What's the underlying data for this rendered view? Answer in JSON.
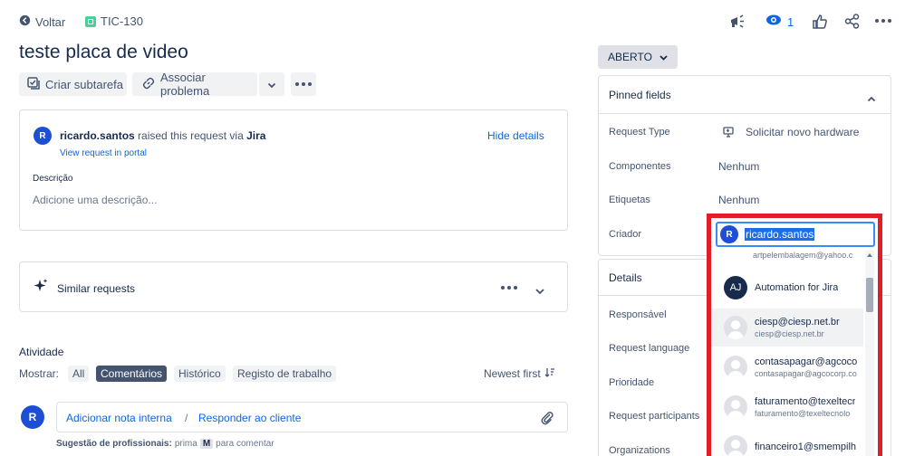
{
  "topbar": {
    "back_label": "Voltar",
    "issue_key": "TIC-130",
    "watch_count": "1"
  },
  "issue": {
    "title": "teste placa de video",
    "buttons": {
      "create_subtask": "Criar subtarefa",
      "link_issue": "Associar problema"
    }
  },
  "request_card": {
    "avatar_letter": "R",
    "user": "ricardo.santos",
    "raised_text": "raised this request via",
    "channel": "Jira",
    "view_portal": "View request in portal",
    "hide_details": "Hide details",
    "description_label": "Descrição",
    "description_placeholder": "Adicione uma descrição..."
  },
  "similar": {
    "label": "Similar requests"
  },
  "activity": {
    "heading": "Atividade",
    "show_label": "Mostrar:",
    "tabs": [
      "All",
      "Comentários",
      "Histórico",
      "Registo de trabalho"
    ],
    "active_tab": "Comentários",
    "sort_label": "Newest first",
    "avatar_letter": "R",
    "add_internal_note": "Adicionar nota interna",
    "separator": "/",
    "reply_customer": "Responder ao cliente",
    "tip_prefix": "Sugestão de profissionais:",
    "tip_press": "prima",
    "tip_key": "M",
    "tip_suffix": "para comentar"
  },
  "status": {
    "label": "ABERTO"
  },
  "pinned": {
    "header": "Pinned fields",
    "fields": [
      {
        "label": "Request Type",
        "value": "Solicitar novo hardware"
      },
      {
        "label": "Componentes",
        "value": "Nenhum"
      },
      {
        "label": "Etiquetas",
        "value": "Nenhum"
      },
      {
        "label": "Criador",
        "value": ""
      }
    ]
  },
  "details": {
    "header": "Details",
    "fields": [
      "Responsável",
      "Request language",
      "Prioridade",
      "Request participants",
      "Organizations"
    ]
  },
  "creator_input": {
    "avatar_letter": "R",
    "value": "ricardo.santos"
  },
  "dropdown": {
    "partial_top": "artpelembalagem@yahoo.c",
    "items": [
      {
        "avatar": "AJ",
        "name": "Automation for Jira",
        "email": ""
      },
      {
        "avatar": "",
        "name": "ciesp@ciesp.net.br",
        "email": "ciesp@ciesp.net.br"
      },
      {
        "avatar": "",
        "name": "contasapagar@agcoco",
        "email": "contasapagar@agcocorp.co"
      },
      {
        "avatar": "",
        "name": "faturamento@texeltecr",
        "email": "faturamento@texeltecnolo"
      },
      {
        "avatar": "",
        "name": "financeiro1@smempilh",
        "email": ""
      }
    ]
  },
  "colors": {
    "accent": "#0c66e4",
    "highlight_box": "#e11d27",
    "active_tab_bg": "#44546f"
  }
}
